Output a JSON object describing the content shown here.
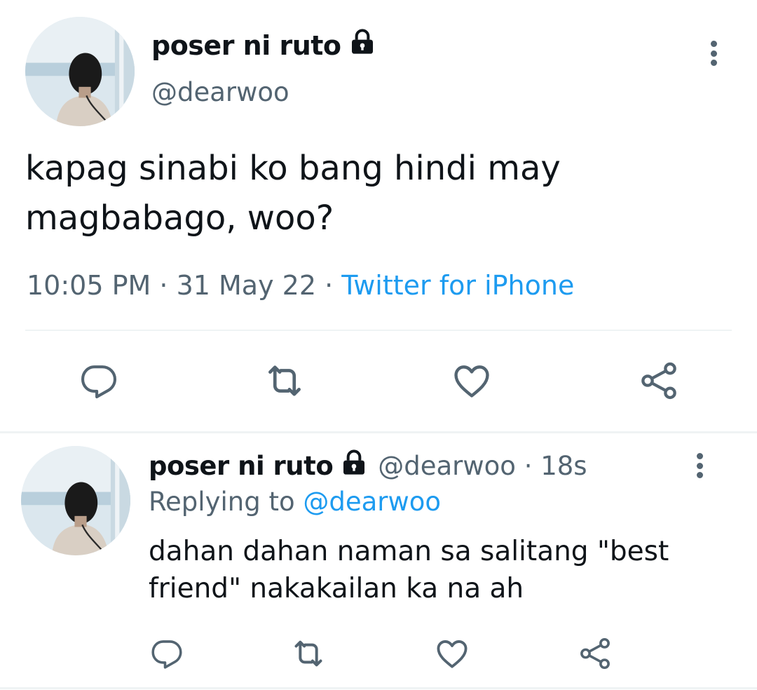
{
  "main_tweet": {
    "display_name": "poser ni ruto",
    "handle": "@dearwoo",
    "text": "kapag sinabi ko bang hindi may magbabago, woo?",
    "time": "10:05 PM",
    "separator": "·",
    "date": "31 May 22",
    "source": "Twitter for iPhone",
    "actions": [
      "reply-icon",
      "retweet-icon",
      "like-icon",
      "share-icon"
    ]
  },
  "reply_tweet": {
    "display_name": "poser ni ruto",
    "handle": "@dearwoo",
    "separator": "·",
    "age": "18s",
    "replying_prefix": "Replying to",
    "replying_handle": "@dearwoo",
    "text": "dahan dahan naman sa salitang \"best friend\" nakakailan ka na ah",
    "actions": [
      "reply-icon",
      "retweet-icon",
      "like-icon",
      "share-icon"
    ]
  },
  "colors": {
    "text": "#0f1419",
    "secondary": "#536471",
    "link": "#1d9bf0",
    "divider": "#eff3f4"
  },
  "icons": {
    "lock": "lock-icon",
    "more": "more-vertical-icon"
  }
}
